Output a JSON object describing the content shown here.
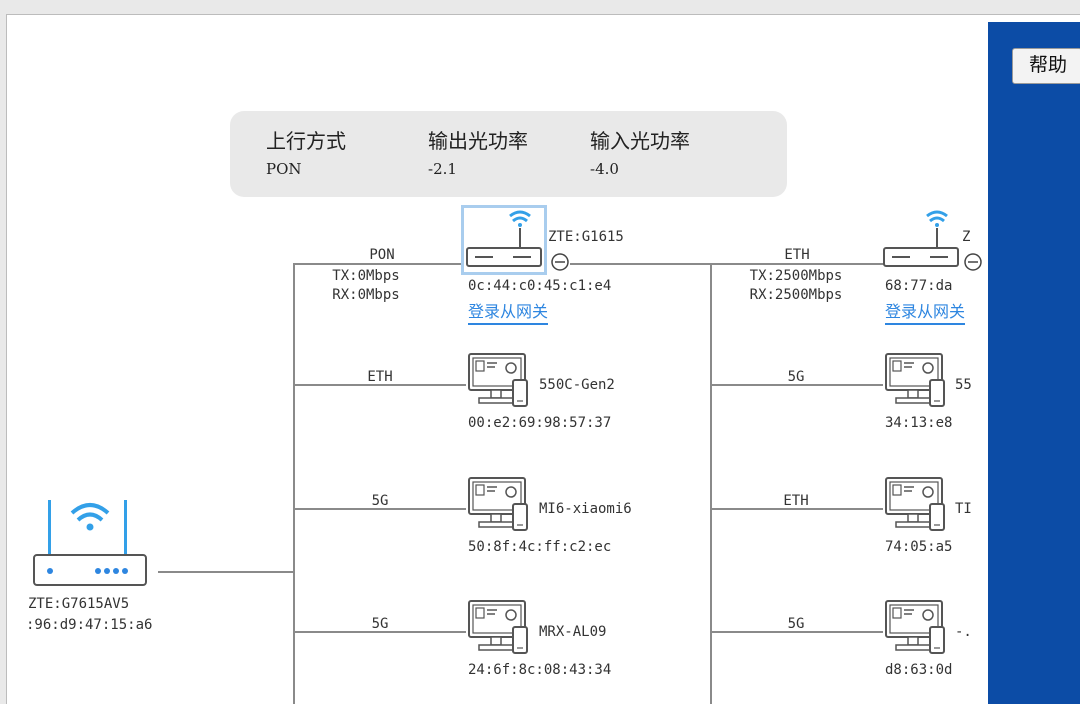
{
  "help_button": "帮助",
  "uplink_info": {
    "headers": [
      "上行方式",
      "输出光功率",
      "输入光功率"
    ],
    "values": [
      "PON",
      "-2.1",
      "-4.0"
    ]
  },
  "main_gateway": {
    "model": "ZTE:G7615AV5",
    "mac": ":96:d9:47:15:a6"
  },
  "sub_gateways": [
    {
      "model": "ZTE:G1615",
      "mac": "0c:44:c0:45:c1:e4",
      "link_type": "PON",
      "tx": "TX:0Mbps",
      "rx": "RX:0Mbps",
      "login": "登录从网关"
    },
    {
      "model": "Z",
      "mac": "68:77:da",
      "link_type": "ETH",
      "tx": "TX:2500Mbps",
      "rx": "RX:2500Mbps",
      "login": "登录从网关"
    }
  ],
  "clients_col1": [
    {
      "link": "ETH",
      "name": "550C-Gen2",
      "mac": "00:e2:69:98:57:37"
    },
    {
      "link": "5G",
      "name": "MI6-xiaomi6",
      "mac": "50:8f:4c:ff:c2:ec"
    },
    {
      "link": "5G",
      "name": "MRX-AL09",
      "mac": "24:6f:8c:08:43:34"
    }
  ],
  "clients_col2": [
    {
      "link": "5G",
      "name": "55",
      "mac": "34:13:e8"
    },
    {
      "link": "ETH",
      "name": "TI",
      "mac": "74:05:a5"
    },
    {
      "link": "5G",
      "name": "-.",
      "mac": "d8:63:0d"
    }
  ],
  "colors": {
    "accent_blue": "#0c4ca6",
    "link_blue": "#2e86e0",
    "wifi_blue": "#33a0e8",
    "selection": "#a9cdee"
  }
}
